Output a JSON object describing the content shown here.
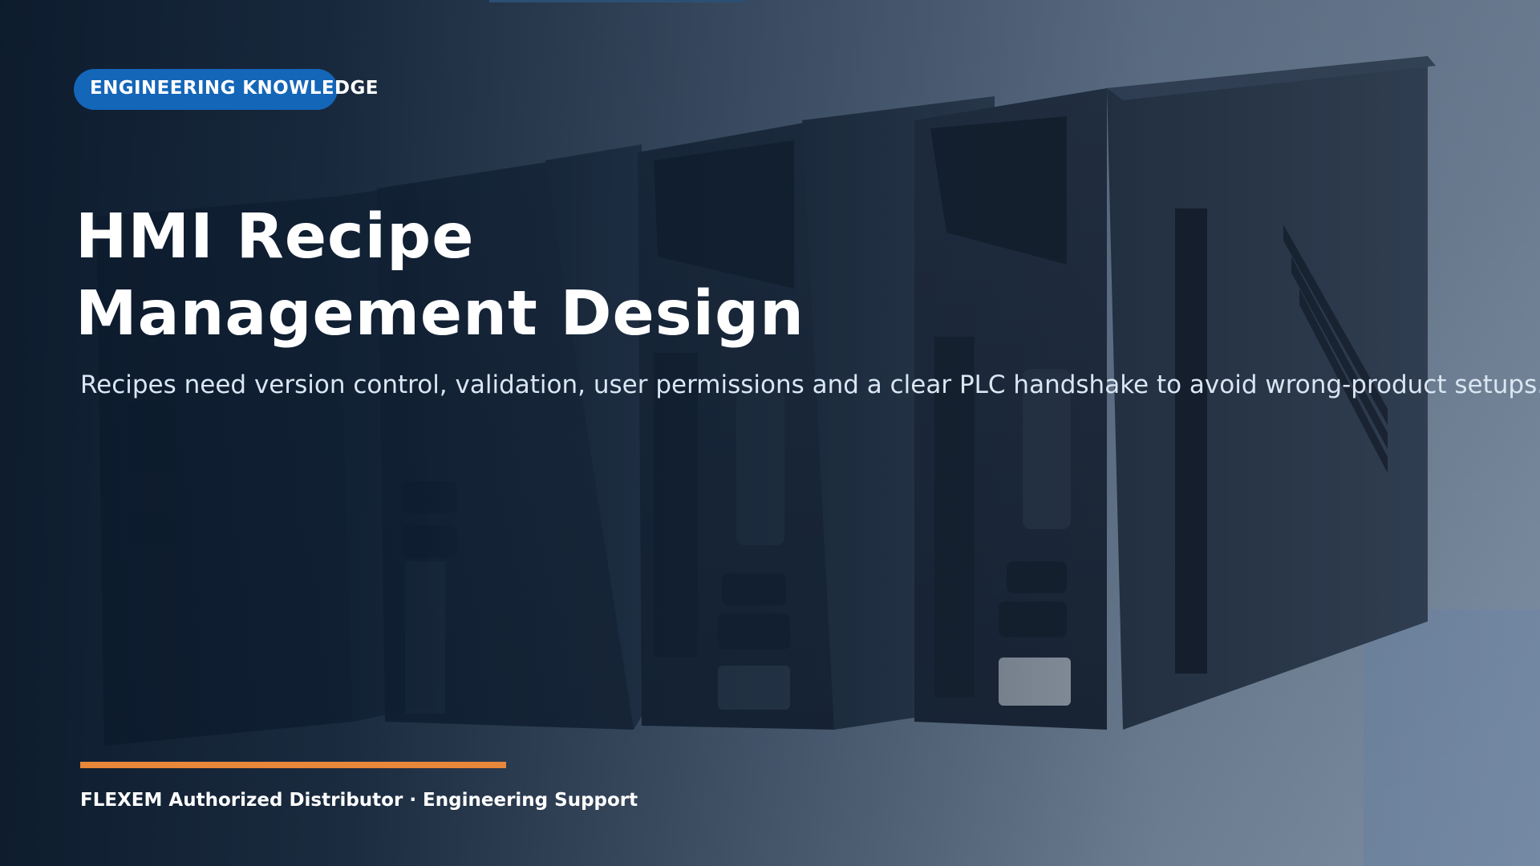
{
  "hero": {
    "tag": "ENGINEERING KNOWLEDGE",
    "title_line1": "HMI Recipe",
    "title_line2": "Management Design",
    "subtitle": "Recipes need version control, validation, user permissions and a clear PLC handshake to avoid wrong-product setups.",
    "footer": "FLEXEM Authorized Distributor · Engineering Support"
  },
  "image": {
    "brand_mark": "FLEXEM",
    "icons": [
      "servo-drive-illustration"
    ]
  },
  "colors": {
    "tag_background": "#1466b8",
    "accent_line": "#e8863a",
    "title_text": "#ffffff",
    "subtitle_text": "#dbe6f2",
    "background_dark": "#0d1a2b"
  }
}
